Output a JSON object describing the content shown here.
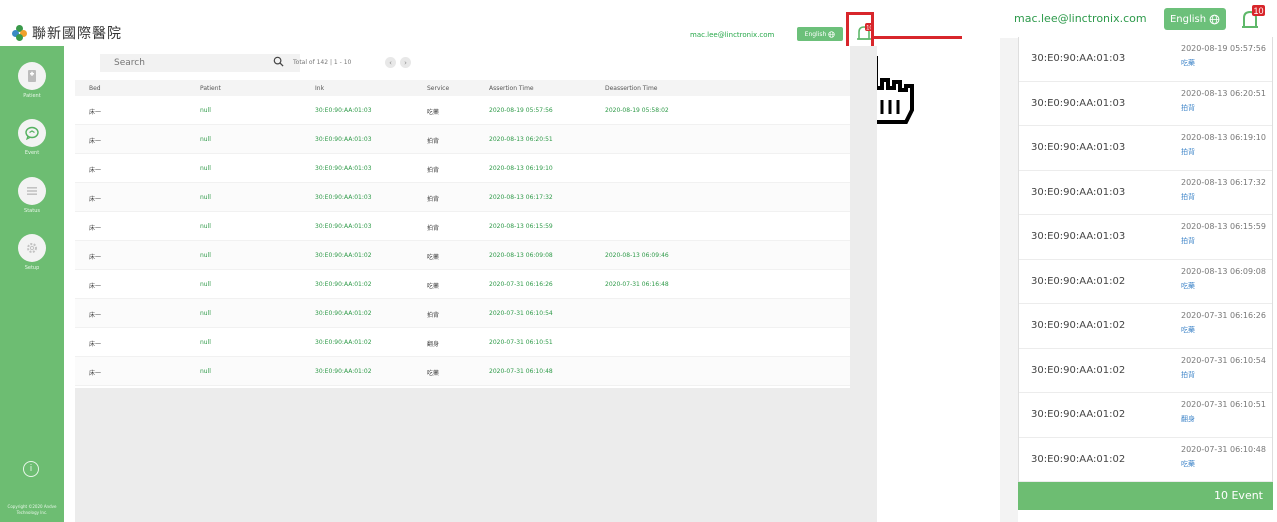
{
  "hospital_name": "聯新國際醫院",
  "user_email": "mac.lee@linctronix.com",
  "language_button": "English",
  "notification_count": "10",
  "sidebar": {
    "items": [
      {
        "label": "Patient",
        "icon": "patient-icon"
      },
      {
        "label": "Event",
        "icon": "chat-icon"
      },
      {
        "label": "Status",
        "icon": "list-icon"
      },
      {
        "label": "Setup",
        "icon": "gear-icon"
      }
    ],
    "copyright": "Copyright ©2020 Andve Technology Inc."
  },
  "search": {
    "placeholder": "Search"
  },
  "pagination": {
    "total_text": "Total of 142 | 1 - 10"
  },
  "table": {
    "columns": [
      "Bed",
      "Patient",
      "Ink",
      "Service",
      "Assertion Time",
      "Deassertion Time"
    ],
    "rows": [
      {
        "bed": "床一",
        "patient": "null",
        "ink": "30:E0:90:AA:01:03",
        "service": "吃藥",
        "assertion": "2020-08-19 05:57:56",
        "deassertion": "2020-08-19 05:58:02"
      },
      {
        "bed": "床一",
        "patient": "null",
        "ink": "30:E0:90:AA:01:03",
        "service": "拍背",
        "assertion": "2020-08-13 06:20:51",
        "deassertion": ""
      },
      {
        "bed": "床一",
        "patient": "null",
        "ink": "30:E0:90:AA:01:03",
        "service": "拍背",
        "assertion": "2020-08-13 06:19:10",
        "deassertion": ""
      },
      {
        "bed": "床一",
        "patient": "null",
        "ink": "30:E0:90:AA:01:03",
        "service": "拍背",
        "assertion": "2020-08-13 06:17:32",
        "deassertion": ""
      },
      {
        "bed": "床一",
        "patient": "null",
        "ink": "30:E0:90:AA:01:03",
        "service": "拍背",
        "assertion": "2020-08-13 06:15:59",
        "deassertion": ""
      },
      {
        "bed": "床一",
        "patient": "null",
        "ink": "30:E0:90:AA:01:02",
        "service": "吃藥",
        "assertion": "2020-08-13 06:09:08",
        "deassertion": "2020-08-13 06:09:46"
      },
      {
        "bed": "床一",
        "patient": "null",
        "ink": "30:E0:90:AA:01:02",
        "service": "吃藥",
        "assertion": "2020-07-31 06:16:26",
        "deassertion": "2020-07-31 06:16:48"
      },
      {
        "bed": "床一",
        "patient": "null",
        "ink": "30:E0:90:AA:01:02",
        "service": "拍背",
        "assertion": "2020-07-31 06:10:54",
        "deassertion": ""
      },
      {
        "bed": "床一",
        "patient": "null",
        "ink": "30:E0:90:AA:01:02",
        "service": "翻身",
        "assertion": "2020-07-31 06:10:51",
        "deassertion": ""
      },
      {
        "bed": "床一",
        "patient": "null",
        "ink": "30:E0:90:AA:01:02",
        "service": "吃藥",
        "assertion": "2020-07-31 06:10:48",
        "deassertion": ""
      }
    ]
  },
  "notification_panel": {
    "items": [
      {
        "mac": "30:E0:90:AA:01:03",
        "time": "2020-08-19 05:57:56",
        "service": "吃藥"
      },
      {
        "mac": "30:E0:90:AA:01:03",
        "time": "2020-08-13 06:20:51",
        "service": "拍背"
      },
      {
        "mac": "30:E0:90:AA:01:03",
        "time": "2020-08-13 06:19:10",
        "service": "拍背"
      },
      {
        "mac": "30:E0:90:AA:01:03",
        "time": "2020-08-13 06:17:32",
        "service": "拍背"
      },
      {
        "mac": "30:E0:90:AA:01:03",
        "time": "2020-08-13 06:15:59",
        "service": "拍背"
      },
      {
        "mac": "30:E0:90:AA:01:02",
        "time": "2020-08-13 06:09:08",
        "service": "吃藥"
      },
      {
        "mac": "30:E0:90:AA:01:02",
        "time": "2020-07-31 06:16:26",
        "service": "吃藥"
      },
      {
        "mac": "30:E0:90:AA:01:02",
        "time": "2020-07-31 06:10:54",
        "service": "拍背"
      },
      {
        "mac": "30:E0:90:AA:01:02",
        "time": "2020-07-31 06:10:51",
        "service": "翻身"
      },
      {
        "mac": "30:E0:90:AA:01:02",
        "time": "2020-07-31 06:10:48",
        "service": "吃藥"
      }
    ],
    "footer": "10 Event"
  },
  "colors": {
    "brand_green": "#6dbd72",
    "link_green": "#2e9a48",
    "highlight_red": "#d8262b"
  }
}
